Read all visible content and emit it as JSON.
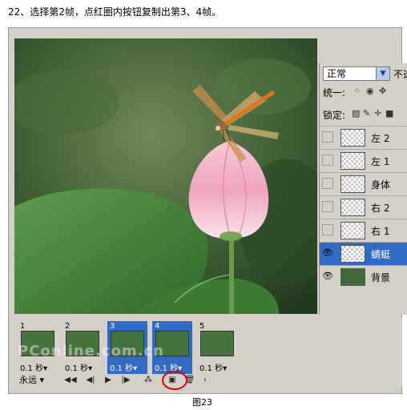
{
  "instruction": "22、选择第2帧，点红圈内按钮复制出第3、4帧。",
  "caption": "图23",
  "layers_panel": {
    "blend_mode": "正常",
    "opacity_label": "不透",
    "unify_label": "统一:",
    "lock_label": "锁定:",
    "layers": [
      {
        "name": "左 2",
        "visible": false,
        "selected": false,
        "thumb": "transparent"
      },
      {
        "name": "左 1",
        "visible": false,
        "selected": false,
        "thumb": "transparent"
      },
      {
        "name": "身体",
        "visible": false,
        "selected": false,
        "thumb": "transparent"
      },
      {
        "name": "右 2",
        "visible": false,
        "selected": false,
        "thumb": "transparent"
      },
      {
        "name": "右 1",
        "visible": false,
        "selected": false,
        "thumb": "transparent"
      },
      {
        "name": "蜻蜓",
        "visible": true,
        "selected": true,
        "thumb": "transparent"
      },
      {
        "name": "背景",
        "visible": true,
        "selected": false,
        "thumb": "photo"
      }
    ]
  },
  "animation_panel": {
    "frames": [
      {
        "number": "1",
        "time": "0.1 秒▾",
        "selected": false
      },
      {
        "number": "2",
        "time": "0.1 秒▾",
        "selected": false
      },
      {
        "number": "3",
        "time": "0.1 秒▾",
        "selected": true
      },
      {
        "number": "4",
        "time": "0.1 秒▾",
        "selected": true
      },
      {
        "number": "5",
        "time": "0.1 秒▾",
        "selected": false
      }
    ],
    "loop_option": "永远"
  },
  "watermark": "PConline.com.cn",
  "colors": {
    "selection": "#316ac5",
    "highlight_circle": "#d40000",
    "panel_bg": "#d4d0c8"
  }
}
